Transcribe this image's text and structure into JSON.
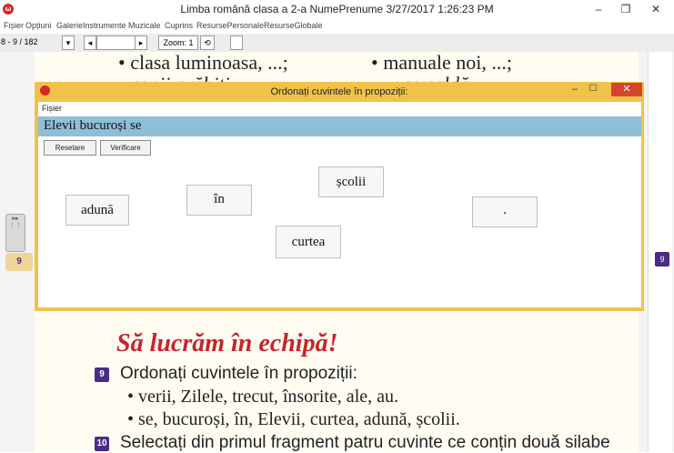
{
  "window": {
    "title": "Limba română clasa a 2-a   NumePrenume  3/27/2017 1:26:23 PM",
    "app_icon_glyph": "ω",
    "minimize": "–",
    "restore": "❐",
    "close": "✕"
  },
  "menu": [
    "Fișier",
    "Opțiuni",
    "GalerieInstrumente Muzicale",
    "Cuprins",
    "ResursePersonale",
    "ResurseGlobale"
  ],
  "toolbar": {
    "page_select": "8 - 9 / 182",
    "zoom_label": "Zoom: 1"
  },
  "book": {
    "top_line_left": "• clasa luminoasa, ...;",
    "top_line_right": "• manuale noi, ...;",
    "cut_line_left": "• copii grăbiți, ...",
    "cut_line_right": "• voce caldă, ...",
    "heading": "Să lucrăm în echipă!",
    "ex9_number": "9",
    "ex9_title": "Ordonați cuvintele în propoziții:",
    "ex9_line1": "• verii, Zilele, trecut, însorite, ale, au.",
    "ex9_line2": "• se, bucuroși, în, Elevii, curtea, adună, școlii.",
    "ex10_number": "10",
    "ex10_title": "Selectați din primul fragment patru cuvinte ce conțin două silabe"
  },
  "dialog": {
    "title": "Ordonați cuvintele în propoziții:",
    "menu_file": "Fișier",
    "sentence": "Elevii bucuroși se",
    "reset_label": "Resetare",
    "verify_label": "Verificare",
    "words": [
      "adună",
      "în",
      "școlii",
      "curtea",
      "."
    ]
  },
  "side": {
    "left_badge": "9",
    "right_badge": "9"
  },
  "colors": {
    "dialog_border": "#f1c24a",
    "sentence_bar": "#8fbfd6",
    "heading_red": "#c8232a",
    "badge_purple": "#4b2c86",
    "close_red": "#d9432b"
  }
}
